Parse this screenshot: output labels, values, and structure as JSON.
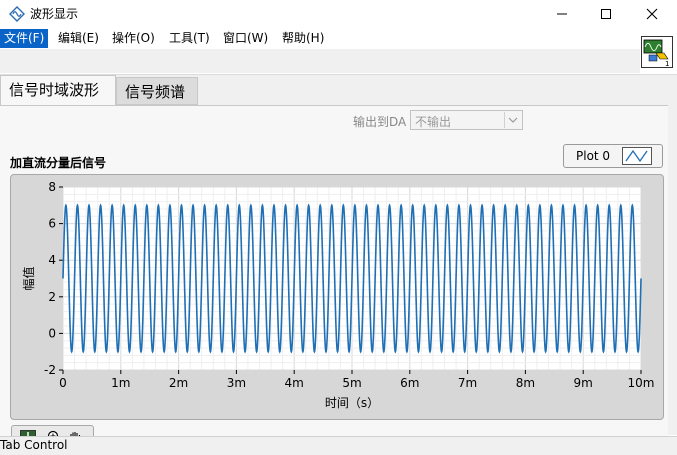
{
  "window": {
    "title": "波形显示"
  },
  "menu": [
    {
      "label": "文件(F)",
      "active": true
    },
    {
      "label": "编辑(E)"
    },
    {
      "label": "操作(O)"
    },
    {
      "label": "工具(T)"
    },
    {
      "label": "窗口(W)"
    },
    {
      "label": "帮助(H)"
    }
  ],
  "tabs": [
    {
      "label": "信号时域波形",
      "selected": true
    },
    {
      "label": "信号频谱",
      "selected": false
    }
  ],
  "da_output": {
    "label": "输出到DA",
    "value": "不输出"
  },
  "graph": {
    "label": "加直流分量后信号",
    "legend": "Plot 0"
  },
  "chart_data": {
    "type": "line",
    "xlabel": "时间（s）",
    "ylabel": "幅值",
    "xlim": [
      0,
      0.01
    ],
    "ylim": [
      -2,
      8
    ],
    "x_tick_labels": [
      "0",
      "1m",
      "2m",
      "3m",
      "4m",
      "5m",
      "6m",
      "7m",
      "8m",
      "9m",
      "10m"
    ],
    "y_tick_labels": [
      "-2",
      "0",
      "2",
      "4",
      "6",
      "8"
    ],
    "grid": true,
    "series": [
      {
        "waveform": "sine",
        "dc_offset": 3,
        "amplitude": 4,
        "frequency_hz": 5000,
        "color": "#1f6fb5"
      }
    ]
  },
  "status": {
    "text": "Tab Control"
  },
  "colors": {
    "plot_line": "#1f6fb5",
    "menu_active": "#0a64c8"
  }
}
